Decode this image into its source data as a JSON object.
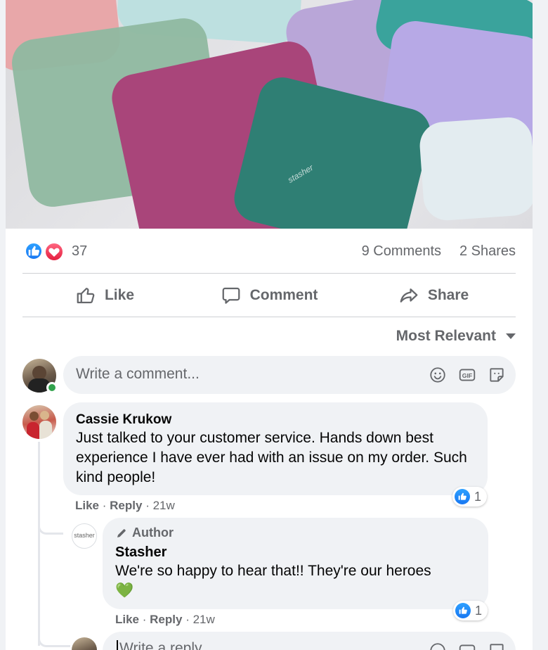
{
  "post": {
    "image_alt": "Colorful reusable silicone storage bags",
    "brand_mark": "stasher"
  },
  "stats": {
    "reaction_count": "37",
    "comments": "9 Comments",
    "shares": "2 Shares"
  },
  "actions": {
    "like": "Like",
    "comment": "Comment",
    "share": "Share"
  },
  "sort": {
    "label": "Most Relevant"
  },
  "composer": {
    "placeholder": "Write a comment..."
  },
  "comments": [
    {
      "author": "Cassie Krukow",
      "text": "Just talked to your customer service. Hands down best experience I have ever had with an issue on my order. Such kind people!",
      "like_label": "Like",
      "reply_label": "Reply",
      "age": "21w",
      "reaction_count": "1",
      "replies": [
        {
          "badge": "Author",
          "author": "Stasher",
          "avatar_text": "stasher",
          "text": "We're so happy to hear that!! They're our heroes 💚",
          "like_label": "Like",
          "reply_label": "Reply",
          "age": "21w",
          "reaction_count": "1"
        }
      ]
    }
  ],
  "reply_composer": {
    "placeholder": "Write a reply..."
  },
  "colors": {
    "facebook_blue": "#1877f2",
    "love_red": "#e41e3f",
    "muted_text": "#65676b",
    "bubble_bg": "#f0f2f5",
    "online_green": "#31a24c"
  }
}
